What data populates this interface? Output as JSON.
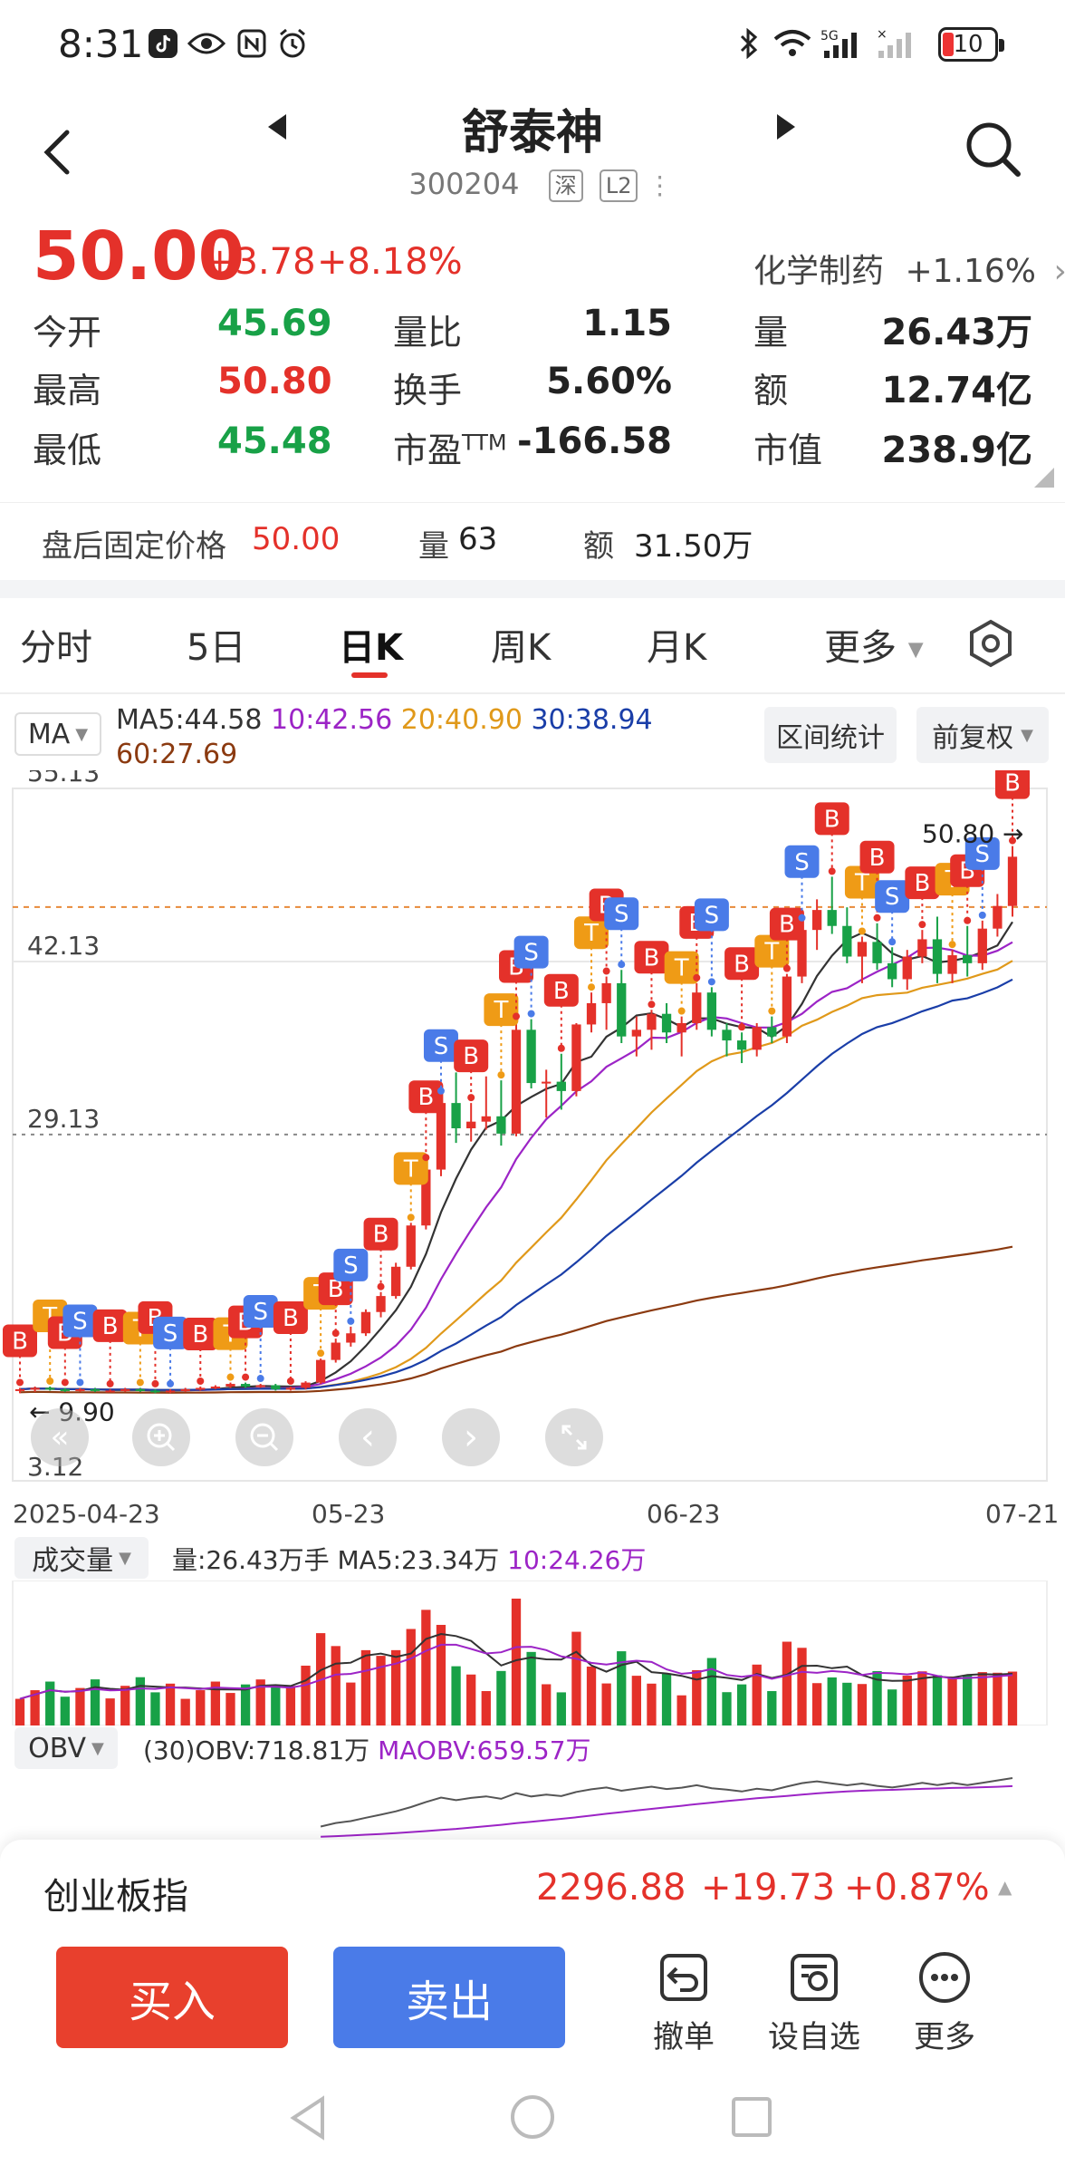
{
  "status_bar": {
    "time": "8:31",
    "battery": "10",
    "icons": [
      "tiktok-icon",
      "eye-icon",
      "nfc-icon",
      "alarm-icon",
      "bluetooth-icon",
      "wifi-icon",
      "signal-5g-icon",
      "signal-icon"
    ]
  },
  "header": {
    "title": "舒泰神",
    "code": "300204",
    "market_tag": "深",
    "level_tag": "L2"
  },
  "quote": {
    "price": "50.00",
    "change": "+3.78",
    "change_pct": "+8.18%",
    "sector": "化学制药",
    "sector_change": "+1.16%",
    "rows": [
      {
        "l1": "今开",
        "v1": "45.69",
        "l2": "量比",
        "v2": "1.15",
        "l3": "量",
        "v3": "26.43万"
      },
      {
        "l1": "最高",
        "v1": "50.80",
        "l2": "换手",
        "v2": "5.60%",
        "l3": "额",
        "v3": "12.74亿"
      },
      {
        "l1": "最低",
        "v1": "45.48",
        "l2": "市盈",
        "l2sup": "TTM",
        "v2": "-166.58",
        "l3": "市值",
        "v3": "238.9亿"
      }
    ],
    "colors": {
      "up": "#e4312a",
      "down": "#18a147"
    }
  },
  "after_hours": {
    "label": "盘后固定价格",
    "price": "50.00",
    "vol_label": "量",
    "vol": "63",
    "amt_label": "额",
    "amt": "31.50万"
  },
  "tabs": [
    {
      "label": "分时",
      "active": false
    },
    {
      "label": "5日",
      "active": false
    },
    {
      "label": "日K",
      "active": true
    },
    {
      "label": "周K",
      "active": false
    },
    {
      "label": "月K",
      "active": false
    },
    {
      "label": "更多",
      "active": false
    }
  ],
  "ma_bar": {
    "selector": "MA",
    "ma5": "MA5:44.58",
    "ma10": "10:42.56",
    "ma20": "20:40.90",
    "ma30": "30:38.94",
    "ma60": "60:27.69",
    "interval_btn": "区间统计",
    "adjust_btn": "前复权"
  },
  "chart_data": [
    {
      "type": "candlestick",
      "y_ticks": [
        "55.13",
        "42.13",
        "29.13",
        "3.12"
      ],
      "ylim": [
        3.12,
        55.13
      ],
      "x_ticks": [
        "2025-04-23",
        "05-23",
        "06-23",
        "07-21"
      ],
      "max_label": "50.80",
      "min_label": "9.90",
      "ohlc": [
        [
          9.9,
          10.1,
          9.7,
          10.0
        ],
        [
          10.0,
          10.2,
          9.8,
          10.1
        ],
        [
          10.1,
          10.2,
          9.9,
          10.0
        ],
        [
          10.0,
          10.1,
          9.8,
          9.9
        ],
        [
          9.9,
          10.1,
          9.8,
          10.0
        ],
        [
          10.0,
          10.1,
          9.8,
          9.9
        ],
        [
          9.9,
          10.0,
          9.8,
          9.9
        ],
        [
          9.9,
          10.1,
          9.8,
          10.0
        ],
        [
          10.0,
          10.1,
          9.8,
          9.9
        ],
        [
          9.9,
          10.0,
          9.7,
          9.8
        ],
        [
          9.8,
          10.0,
          9.7,
          9.9
        ],
        [
          9.9,
          10.1,
          9.8,
          10.0
        ],
        [
          10.0,
          10.2,
          9.9,
          10.1
        ],
        [
          10.1,
          10.3,
          10.0,
          10.2
        ],
        [
          10.2,
          10.5,
          10.1,
          10.4
        ],
        [
          10.4,
          10.5,
          10.1,
          10.2
        ],
        [
          10.2,
          10.4,
          10.1,
          10.3
        ],
        [
          10.3,
          10.4,
          9.9,
          10.0
        ],
        [
          10.0,
          10.2,
          9.9,
          10.1
        ],
        [
          10.1,
          10.6,
          10.0,
          10.5
        ],
        [
          10.5,
          12.3,
          10.4,
          12.2
        ],
        [
          12.2,
          13.8,
          12.0,
          13.5
        ],
        [
          13.5,
          14.7,
          13.2,
          14.2
        ],
        [
          14.2,
          16.0,
          14.0,
          15.8
        ],
        [
          15.8,
          17.3,
          15.4,
          17.0
        ],
        [
          17.0,
          19.5,
          16.8,
          19.2
        ],
        [
          19.2,
          22.5,
          19.0,
          22.3
        ],
        [
          22.3,
          27.0,
          22.0,
          26.5
        ],
        [
          26.5,
          32.0,
          26.0,
          31.5
        ],
        [
          31.5,
          33.8,
          28.5,
          29.6
        ],
        [
          29.6,
          31.5,
          28.6,
          30.1
        ],
        [
          30.1,
          33.5,
          29.5,
          30.5
        ],
        [
          30.5,
          33.2,
          28.3,
          29.2
        ],
        [
          29.2,
          37.6,
          29.0,
          37.0
        ],
        [
          37.0,
          37.8,
          32.6,
          33.0
        ],
        [
          33.0,
          34.0,
          30.4,
          33.1
        ],
        [
          33.1,
          35.2,
          31.0,
          32.4
        ],
        [
          32.4,
          37.5,
          32.0,
          37.4
        ],
        [
          37.4,
          39.8,
          36.8,
          39.0
        ],
        [
          39.0,
          41.0,
          37.0,
          40.5
        ],
        [
          40.5,
          41.5,
          36.0,
          36.5
        ],
        [
          36.5,
          38.0,
          35.0,
          37.0
        ],
        [
          37.0,
          38.5,
          35.5,
          38.2
        ],
        [
          38.2,
          39.0,
          36.0,
          36.8
        ],
        [
          36.8,
          38.0,
          35.0,
          37.5
        ],
        [
          37.5,
          40.5,
          37.0,
          39.8
        ],
        [
          39.8,
          40.2,
          36.5,
          37.0
        ],
        [
          37.0,
          37.5,
          35.0,
          36.2
        ],
        [
          36.2,
          36.8,
          34.5,
          35.5
        ],
        [
          35.5,
          37.5,
          35.0,
          37.2
        ],
        [
          37.2,
          38.0,
          36.0,
          36.5
        ],
        [
          36.5,
          41.2,
          36.0,
          41.0
        ],
        [
          41.0,
          45.0,
          40.5,
          44.5
        ],
        [
          44.5,
          46.8,
          43.0,
          46.0
        ],
        [
          46.0,
          48.5,
          44.2,
          44.8
        ],
        [
          44.8,
          46.2,
          42.0,
          42.5
        ],
        [
          42.5,
          44.0,
          40.5,
          43.6
        ],
        [
          43.6,
          45.0,
          41.5,
          42.0
        ],
        [
          42.0,
          43.2,
          40.2,
          40.8
        ],
        [
          40.8,
          43.0,
          40.0,
          42.5
        ],
        [
          42.5,
          44.5,
          42.0,
          43.8
        ],
        [
          43.8,
          45.5,
          40.5,
          41.2
        ],
        [
          41.2,
          43.0,
          40.5,
          42.6
        ],
        [
          42.6,
          44.8,
          41.0,
          42.0
        ],
        [
          42.0,
          45.2,
          41.5,
          44.6
        ],
        [
          44.6,
          47.2,
          44.0,
          46.3
        ],
        [
          46.3,
          50.8,
          45.5,
          50.0
        ]
      ],
      "ma_colors": {
        "ma5": "#333333",
        "ma10": "#9c24c6",
        "ma20": "#e0991a",
        "ma30": "#1a3ea8",
        "ma60": "#8b3a10"
      },
      "signals": "B / S / T trade markers above candles"
    },
    {
      "type": "bar",
      "title": "成交量",
      "stats": {
        "vol": "量:26.43万手",
        "ma5": "MA5:23.34万",
        "ma10": "10:24.26万"
      }
    },
    {
      "type": "line",
      "title": "OBV",
      "stats": {
        "obv": "(30)OBV:718.81万",
        "maobv": "MAOBV:659.57万"
      }
    }
  ],
  "index_bar": {
    "name": "创业板指",
    "value": "2296.88",
    "change": "+19.73",
    "change_pct": "+0.87%"
  },
  "actions": {
    "buy": "买入",
    "sell": "卖出",
    "cancel": "撤单",
    "watchlist": "设自选",
    "more": "更多"
  }
}
